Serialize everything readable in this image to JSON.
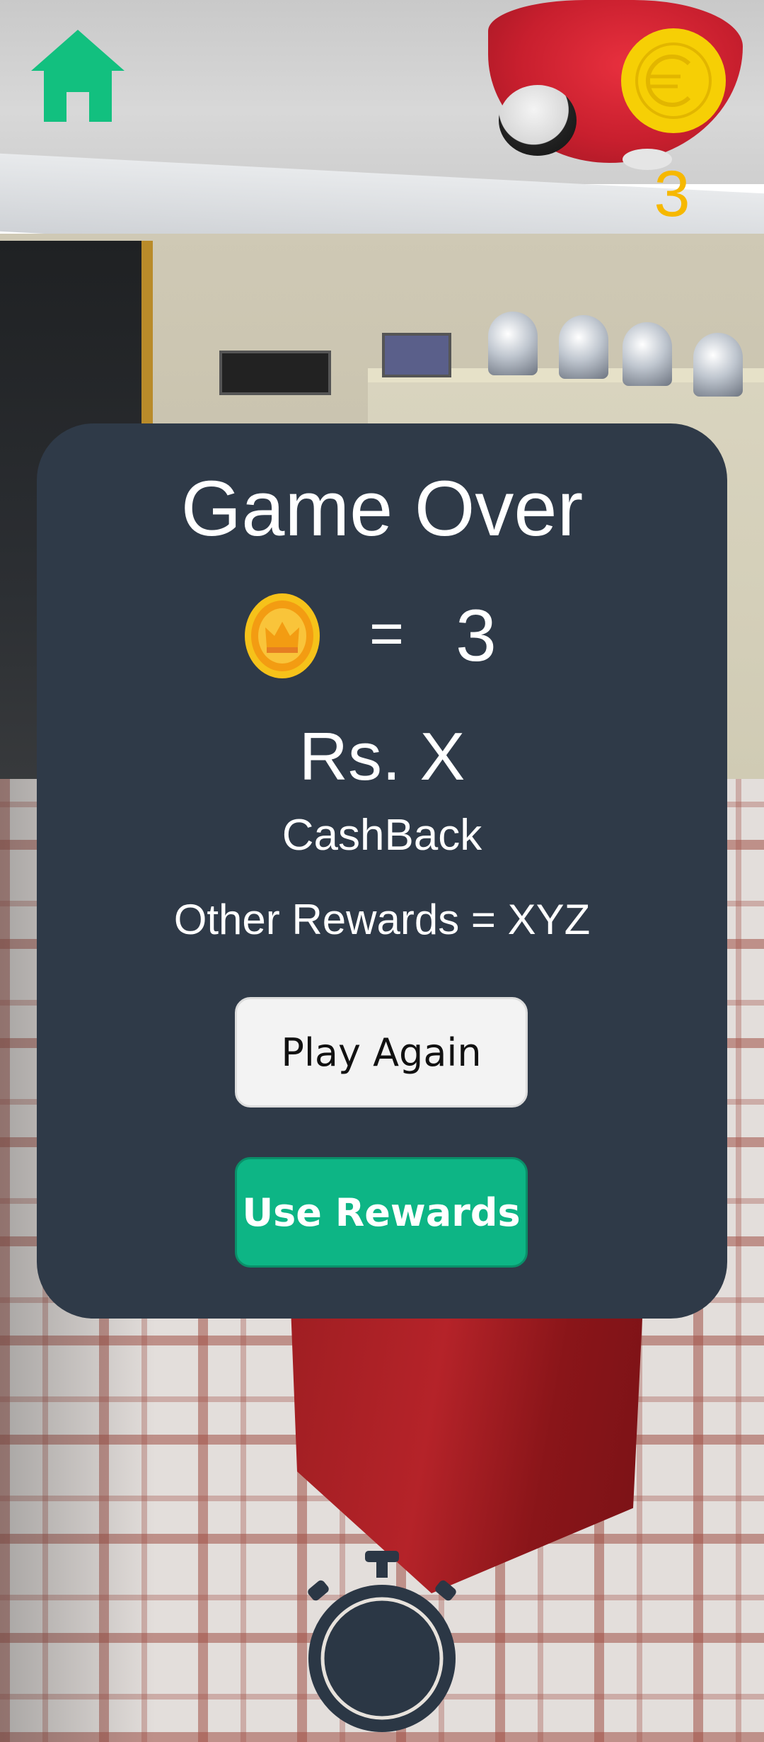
{
  "hud": {
    "home_icon": "home-icon",
    "coin_icon": "euro-coin-icon",
    "coin_count": "3"
  },
  "dialog": {
    "title": "Game Over",
    "score": {
      "coin_icon": "crown-coin-icon",
      "equals": "=",
      "value": "3"
    },
    "amount": "Rs. X",
    "amount_caption": "CashBack",
    "other_rewards": "Other Rewards = XYZ",
    "play_again_label": "Play Again",
    "use_rewards_label": "Use Rewards"
  },
  "timer": {
    "icon": "stopwatch-icon"
  },
  "colors": {
    "panel": "#2f3a48",
    "accent_green": "#0db585",
    "coin_gold": "#f6b800",
    "home_green": "#12c07f"
  }
}
